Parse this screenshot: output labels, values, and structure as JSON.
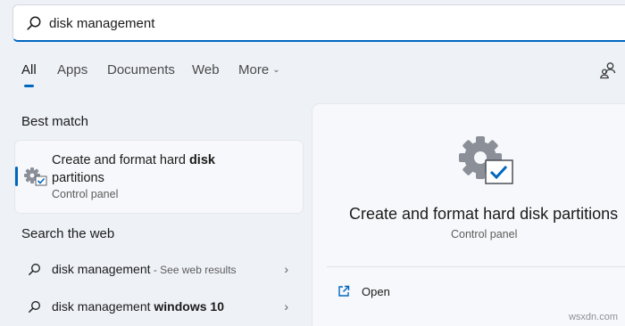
{
  "search": {
    "value": "disk management"
  },
  "tabs": [
    "All",
    "Apps",
    "Documents",
    "Web",
    "More"
  ],
  "best_match": {
    "heading": "Best match",
    "title_part1": "Create and format hard ",
    "title_bold": "disk",
    "title_part2": "partitions",
    "subtitle": "Control panel"
  },
  "web": {
    "heading": "Search the web",
    "results": [
      {
        "query": "disk management",
        "suffix": " - See web results",
        "bold": ""
      },
      {
        "query": "disk management",
        "suffix": "",
        "bold": " windows 10"
      }
    ]
  },
  "detail": {
    "title": "Create and format hard disk partitions",
    "subtitle": "Control panel",
    "actions": [
      "Open"
    ]
  },
  "watermark": "wsxdn.com",
  "colors": {
    "accent": "#0067c0",
    "background": "#eef1f6",
    "card": "#f7f8fb"
  }
}
